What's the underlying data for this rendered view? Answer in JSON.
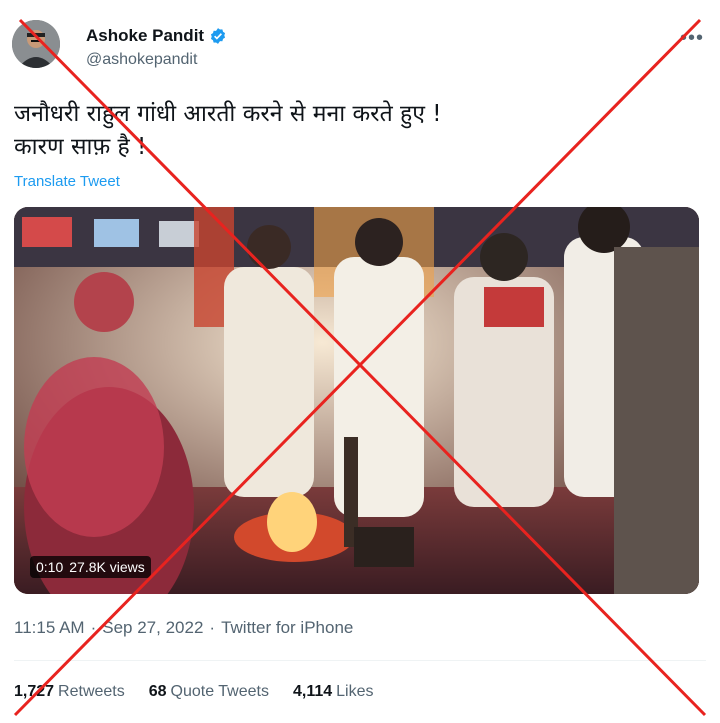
{
  "author": {
    "display_name": "Ashoke Pandit",
    "handle": "@ashokepandit"
  },
  "more_icon": "•••",
  "tweet_text": {
    "line1": "जनौधरी राहुल गांधी आरती करने से मना करते हुए !",
    "line2": "कारण साफ़ है !"
  },
  "translate_label": "Translate Tweet",
  "video": {
    "duration": "0:10",
    "views": "27.8K views"
  },
  "meta": {
    "time": "11:15 AM",
    "separator": "·",
    "date": "Sep 27, 2022",
    "source": "Twitter for iPhone"
  },
  "stats": {
    "retweets_count": "1,727",
    "retweets_label": "Retweets",
    "quotes_count": "68",
    "quotes_label": "Quote Tweets",
    "likes_count": "4,114",
    "likes_label": "Likes"
  },
  "colors": {
    "accent": "#1d9bf0",
    "cross": "#e8231f",
    "muted": "#536471"
  }
}
